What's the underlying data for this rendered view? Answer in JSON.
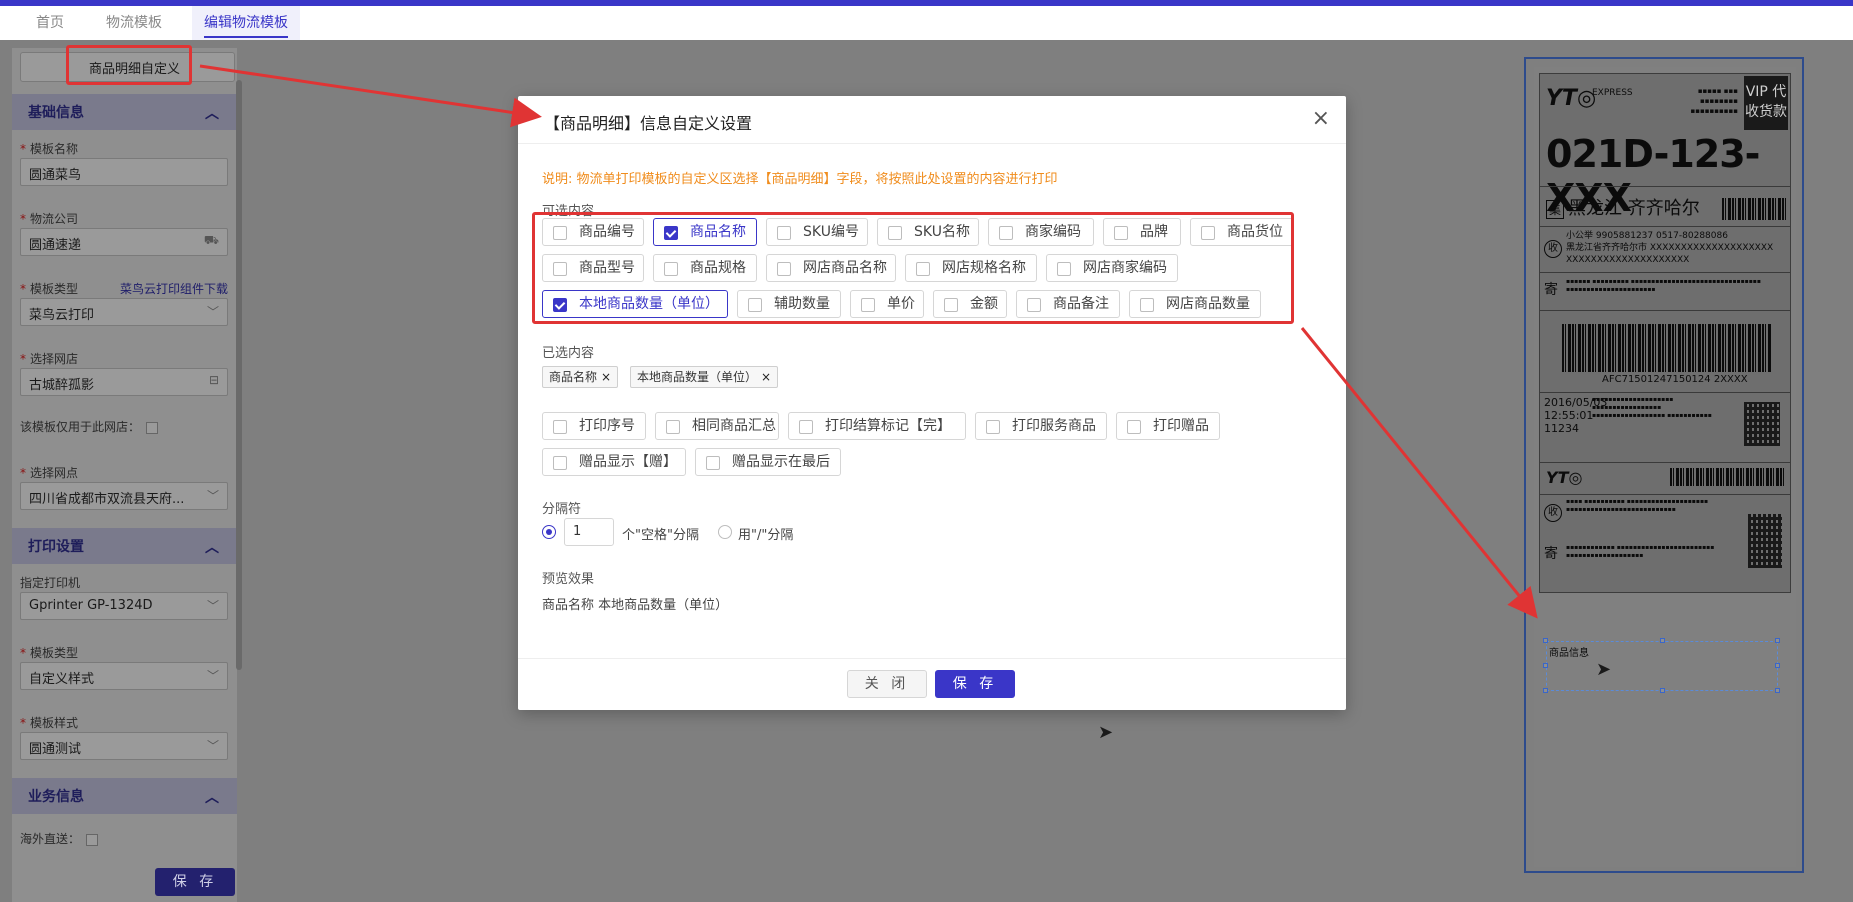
{
  "tabs": [
    {
      "label": "首页"
    },
    {
      "label": "物流模板"
    },
    {
      "label": "编辑物流模板"
    }
  ],
  "sidebar": {
    "top_button": "商品明细自定义",
    "basic_section": "基础信息",
    "template_name_label": "模板名称",
    "template_name_value": "圆通菜鸟",
    "logistics_company_label": "物流公司",
    "logistics_company_value": "圆通速递",
    "template_type_label": "模板类型",
    "template_type_link": "菜鸟云打印组件下载",
    "template_type_value": "菜鸟云打印",
    "shop_label": "选择网店",
    "shop_value": "古城醉孤影",
    "shop_only_label": "该模板仅用于此网店：",
    "branch_label": "选择网点",
    "branch_value": "四川省成都市双流县天府...",
    "print_section": "打印设置",
    "printer_label": "指定打印机",
    "printer_value": "Gprinter GP-1324D",
    "template_type2_label": "模板类型",
    "template_type2_value": "自定义样式",
    "template_style_label": "模板样式",
    "template_style_value": "圆通测试",
    "business_section": "业务信息",
    "overseas_label": "海外直送：",
    "save_button": "保 存"
  },
  "modal": {
    "title": "【商品明细】信息自定义设置",
    "note": "说明: 物流单打印模板的自定义区选择【商品明细】字段，将按照此处设置的内容进行打印",
    "optional_label": "可选内容",
    "optional_options": [
      {
        "label": "商品编号",
        "checked": false
      },
      {
        "label": "商品名称",
        "checked": true
      },
      {
        "label": "SKU编号",
        "checked": false
      },
      {
        "label": "SKU名称",
        "checked": false
      },
      {
        "label": "商家编码",
        "checked": false
      },
      {
        "label": "品牌",
        "checked": false
      },
      {
        "label": "商品货位",
        "checked": false
      },
      {
        "label": "商品型号",
        "checked": false
      },
      {
        "label": "商品规格",
        "checked": false
      },
      {
        "label": "网店商品名称",
        "checked": false
      },
      {
        "label": "网店规格名称",
        "checked": false
      },
      {
        "label": "网店商家编码",
        "checked": false
      },
      {
        "label": "本地商品数量（单位）",
        "checked": true
      },
      {
        "label": "辅助数量",
        "checked": false
      },
      {
        "label": "单价",
        "checked": false
      },
      {
        "label": "金额",
        "checked": false
      },
      {
        "label": "商品备注",
        "checked": false
      },
      {
        "label": "网店商品数量",
        "checked": false
      }
    ],
    "selected_label": "已选内容",
    "selected_tags": [
      "商品名称",
      "本地商品数量（单位）"
    ],
    "extra_options": [
      {
        "label": "打印序号",
        "checked": false
      },
      {
        "label": "相同商品汇总",
        "checked": false
      },
      {
        "label": "打印结算标记【完】",
        "checked": false
      },
      {
        "label": "打印服务商品",
        "checked": false
      },
      {
        "label": "打印赠品",
        "checked": false
      },
      {
        "label": "赠品显示【赠】",
        "checked": false
      },
      {
        "label": "赠品显示在最后",
        "checked": false
      }
    ],
    "separator_label": "分隔符",
    "separator_count": "1",
    "separator_space_text": "个\"空格\"分隔",
    "separator_slash_text": "用\"/\"分隔",
    "preview_label": "预览效果",
    "preview_value": "商品名称 本地商品数量（单位）",
    "close_button": "关 闭",
    "save_button": "保 存"
  },
  "label_preview": {
    "vip_text": "VIP 代收货款",
    "code": "021D-123-XXX",
    "province": "黑龙江 齐齐哈尔",
    "province_badge": "集",
    "phone_line": "小公举   9905881237  0517-80288086",
    "address": "黑龙江省齐齐哈尔市 XXXXXXXXXXXXXXXXXXXX XXXXXXXXXXXXXXXXXXXX",
    "tracking": "AFC71501247150124 2XXXX",
    "date": "2016/05/03",
    "time": "12:55:01",
    "number": "11234",
    "goods_info": "商品信息"
  },
  "colors": {
    "accent": "#3a36c8",
    "note": "#f08c1c",
    "callout": "#e03434"
  }
}
